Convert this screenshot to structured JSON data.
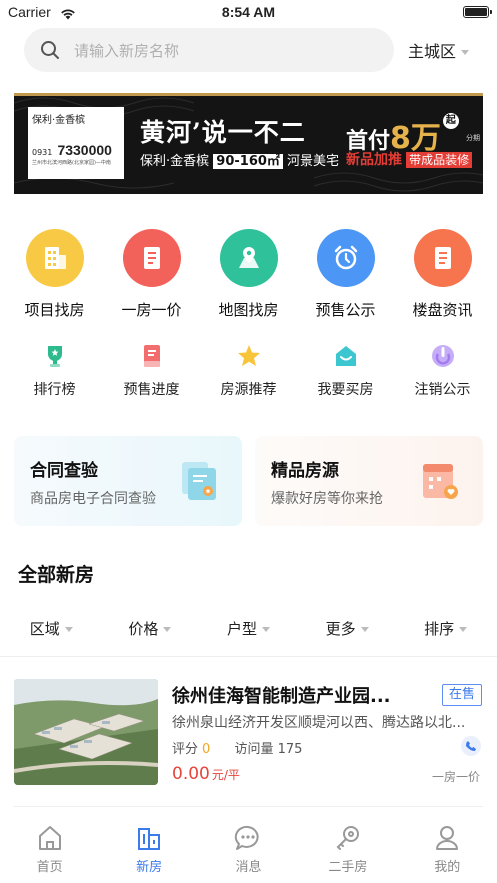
{
  "status_bar": {
    "carrier": "Carrier",
    "time": "8:54 AM"
  },
  "search": {
    "placeholder": "请输入新房名称"
  },
  "city": "主城区",
  "banner": {
    "logo_text": "保利·金香槟",
    "phone_prefix": "0931",
    "phone": "7330000",
    "address": "兰州市北滨河西路(北京家园)—中南",
    "headline": "黄河’说一不二",
    "sub_brand": "保利·金香槟",
    "sub_area": "90-160㎡",
    "sub_end": "河景美宅",
    "first_pay": "首付",
    "first_pay_amount": "8万",
    "qi": "起",
    "installment": "分期",
    "new_item": "新品",
    "new_push": "加推",
    "decor_tag": "带成品装修"
  },
  "main_icons": [
    {
      "label": "项目找房",
      "icon": "building-grid-icon",
      "color": "#f8c944"
    },
    {
      "label": "一房一价",
      "icon": "building-doc-icon",
      "color": "#f2625a"
    },
    {
      "label": "地图找房",
      "icon": "map-pin-icon",
      "color": "#2fc19a"
    },
    {
      "label": "预售公示",
      "icon": "alarm-clock-icon",
      "color": "#4c97f5"
    },
    {
      "label": "楼盘资讯",
      "icon": "news-doc-icon",
      "color": "#f6744e"
    }
  ],
  "secondary_icons": [
    {
      "label": "排行榜",
      "icon": "trophy-icon",
      "color": "#2dbb8d"
    },
    {
      "label": "预售进度",
      "icon": "progress-doc-icon",
      "color": "#f26d6d"
    },
    {
      "label": "房源推荐",
      "icon": "star-icon",
      "color": "#f7c43a"
    },
    {
      "label": "我要买房",
      "icon": "house-cart-icon",
      "color": "#3cc6cf"
    },
    {
      "label": "注销公示",
      "icon": "power-icon",
      "color": "#a57cf0"
    }
  ],
  "feature_cards": [
    {
      "title": "合同查验",
      "desc": "商品房电子合同查验"
    },
    {
      "title": "精品房源",
      "desc": "爆款好房等你来抢"
    }
  ],
  "section_title": "全部新房",
  "filters": [
    "区域",
    "价格",
    "户型",
    "更多",
    "排序"
  ],
  "listing": {
    "name": "徐州佳海智能制造产业园...",
    "status": "在售",
    "address": "徐州泉山经济开发区顺堤河以西、腾达路以北...",
    "score_label": "评分",
    "score": "0",
    "visits_label": "访问量",
    "visits": "175",
    "price": "0.00",
    "price_unit": "元/平",
    "tag": "一房一价"
  },
  "tabs": [
    {
      "label": "首页",
      "icon": "home-icon",
      "active": false
    },
    {
      "label": "新房",
      "icon": "new-house-icon",
      "active": true
    },
    {
      "label": "消息",
      "icon": "message-icon",
      "active": false
    },
    {
      "label": "二手房",
      "icon": "key-icon",
      "active": false
    },
    {
      "label": "我的",
      "icon": "profile-icon",
      "active": false
    }
  ],
  "colors": {
    "accent": "#3d7bea",
    "price": "#e6453c",
    "score": "#f5a623"
  }
}
